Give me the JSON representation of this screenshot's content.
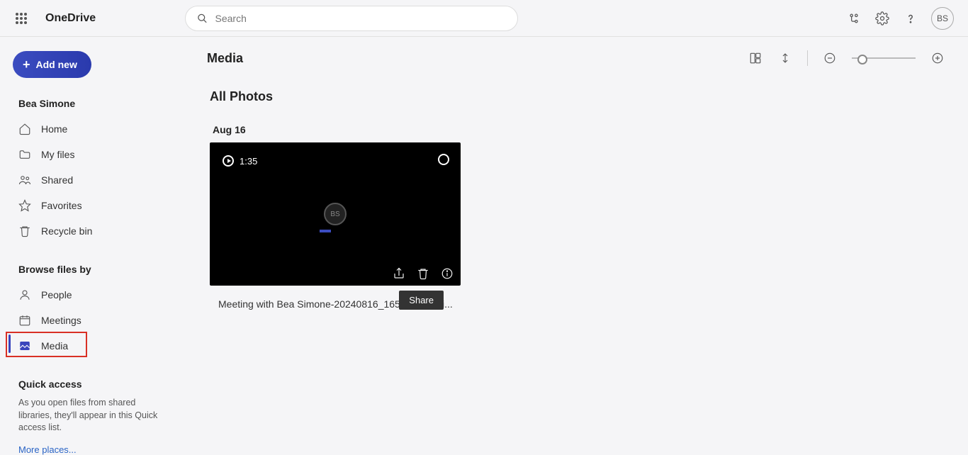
{
  "header": {
    "brand": "OneDrive",
    "search_placeholder": "Search",
    "avatar_initials": "BS"
  },
  "sidebar": {
    "add_new_label": "Add new",
    "user_name": "Bea Simone",
    "nav": {
      "home": "Home",
      "my_files": "My files",
      "shared": "Shared",
      "favorites": "Favorites",
      "recycle": "Recycle bin"
    },
    "browse_title": "Browse files by",
    "browse": {
      "people": "People",
      "meetings": "Meetings",
      "media": "Media"
    },
    "quick_access_title": "Quick access",
    "quick_access_desc": "As you open files from shared libraries, they'll appear in this Quick access list.",
    "more_places": "More places..."
  },
  "main": {
    "title": "Media",
    "subtitle": "All Photos",
    "date_group": "Aug 16",
    "video": {
      "duration": "1:35",
      "center_initials": "BS",
      "filename": "Meeting with Bea Simone-20240816_165242-Meeti...",
      "tooltip": "Share"
    }
  }
}
